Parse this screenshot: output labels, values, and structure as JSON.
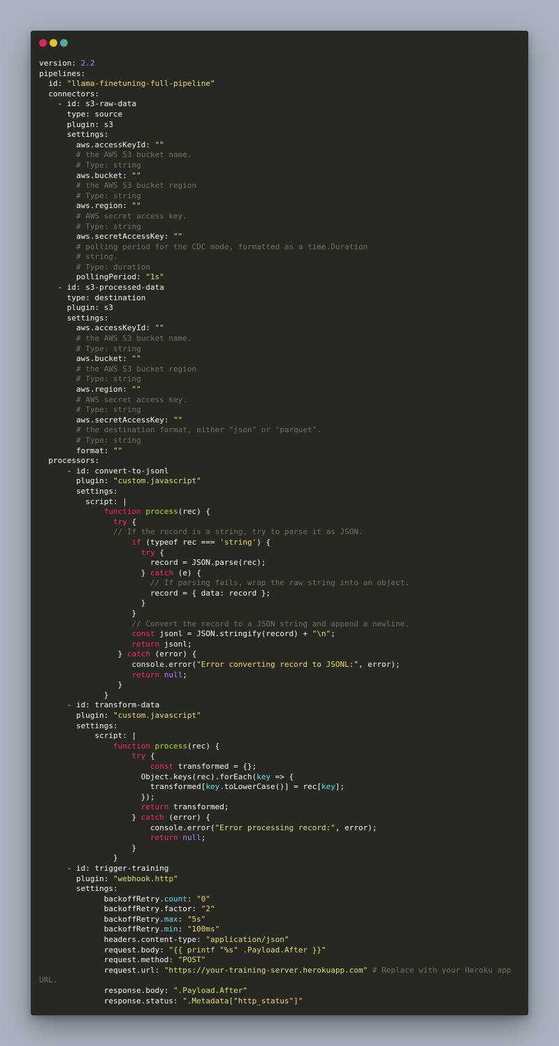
{
  "window": {
    "dots": [
      {
        "name": "close-dot",
        "color": "#e0245e"
      },
      {
        "name": "minimize-dot",
        "color": "#e6c229"
      },
      {
        "name": "zoom-dot",
        "color": "#4ea99a"
      }
    ]
  },
  "code": {
    "lines": [
      [
        [
          "version: ",
          "plain"
        ],
        [
          "2.2",
          "num"
        ]
      ],
      [
        [
          "pipelines:",
          "plain"
        ]
      ],
      [
        [
          "  id: ",
          "plain"
        ],
        [
          "\"llama-finetuning-full-pipeline\"",
          "str"
        ]
      ],
      [
        [
          "  connectors:",
          "plain"
        ]
      ],
      [
        [
          "    - id: s3-raw-data",
          "plain"
        ]
      ],
      [
        [
          "      type: source",
          "plain"
        ]
      ],
      [
        [
          "      plugin: s3",
          "plain"
        ]
      ],
      [
        [
          "      settings:",
          "plain"
        ]
      ],
      [
        [
          "        aws.accessKeyId: ",
          "plain"
        ],
        [
          "\"\"",
          "str"
        ]
      ],
      [
        [
          "        # the AWS S3 bucket name.",
          "com"
        ]
      ],
      [
        [
          "        # Type: string",
          "com"
        ]
      ],
      [
        [
          "        aws.bucket: ",
          "plain"
        ],
        [
          "\"\"",
          "str"
        ]
      ],
      [
        [
          "        # the AWS S3 bucket region",
          "com"
        ]
      ],
      [
        [
          "        # Type: string",
          "com"
        ]
      ],
      [
        [
          "        aws.region: ",
          "plain"
        ],
        [
          "\"\"",
          "str"
        ]
      ],
      [
        [
          "        # AWS secret access key.",
          "com"
        ]
      ],
      [
        [
          "        # Type: string",
          "com"
        ]
      ],
      [
        [
          "        aws.secretAccessKey: ",
          "plain"
        ],
        [
          "\"\"",
          "str"
        ]
      ],
      [
        [
          "        # polling period for the CDC mode, formatted as a time.Duration",
          "com"
        ]
      ],
      [
        [
          "        # string.",
          "com"
        ]
      ],
      [
        [
          "        # Type: duration",
          "com"
        ]
      ],
      [
        [
          "        pollingPeriod: ",
          "plain"
        ],
        [
          "\"1s\"",
          "str"
        ]
      ],
      [
        [
          "    - id: s3-processed-data",
          "plain"
        ]
      ],
      [
        [
          "      type: destination",
          "plain"
        ]
      ],
      [
        [
          "      plugin: s3",
          "plain"
        ]
      ],
      [
        [
          "      settings:",
          "plain"
        ]
      ],
      [
        [
          "        aws.accessKeyId: ",
          "plain"
        ],
        [
          "\"\"",
          "str"
        ]
      ],
      [
        [
          "        # the AWS S3 bucket name.",
          "com"
        ]
      ],
      [
        [
          "        # Type: string",
          "com"
        ]
      ],
      [
        [
          "        aws.bucket: ",
          "plain"
        ],
        [
          "\"\"",
          "str"
        ]
      ],
      [
        [
          "        # the AWS S3 bucket region",
          "com"
        ]
      ],
      [
        [
          "        # Type: string",
          "com"
        ]
      ],
      [
        [
          "        aws.region: ",
          "plain"
        ],
        [
          "\"\"",
          "str"
        ]
      ],
      [
        [
          "        # AWS secret access key.",
          "com"
        ]
      ],
      [
        [
          "        # Type: string",
          "com"
        ]
      ],
      [
        [
          "        aws.secretAccessKey: ",
          "plain"
        ],
        [
          "\"\"",
          "str"
        ]
      ],
      [
        [
          "        # the destination format, either \"json\" or \"parquet\".",
          "com"
        ]
      ],
      [
        [
          "        # Type: string",
          "com"
        ]
      ],
      [
        [
          "        format: ",
          "plain"
        ],
        [
          "\"\"",
          "str"
        ]
      ],
      [
        [
          "  processors:",
          "plain"
        ]
      ],
      [
        [
          "      - id: convert-to-jsonl",
          "plain"
        ]
      ],
      [
        [
          "        plugin: ",
          "plain"
        ],
        [
          "\"custom.javascript\"",
          "str"
        ]
      ],
      [
        [
          "        settings:",
          "plain"
        ]
      ],
      [
        [
          "          script: |",
          "plain"
        ]
      ],
      [
        [
          "              ",
          "plain"
        ],
        [
          "function",
          "kw"
        ],
        [
          " ",
          "plain"
        ],
        [
          "process",
          "fn"
        ],
        [
          "(rec) {",
          "plain"
        ]
      ],
      [
        [
          "                ",
          "plain"
        ],
        [
          "try",
          "kw"
        ],
        [
          " {",
          "plain"
        ]
      ],
      [
        [
          "                // If the record is a string, try to parse it as JSON.",
          "com"
        ]
      ],
      [
        [
          "                    ",
          "plain"
        ],
        [
          "if",
          "kw"
        ],
        [
          " (typeof rec === ",
          "plain"
        ],
        [
          "'string'",
          "str"
        ],
        [
          ") {",
          "plain"
        ]
      ],
      [
        [
          "                      ",
          "plain"
        ],
        [
          "try",
          "kw"
        ],
        [
          " {",
          "plain"
        ]
      ],
      [
        [
          "                        record = JSON.parse(rec);",
          "plain"
        ]
      ],
      [
        [
          "                      } ",
          "plain"
        ],
        [
          "catch",
          "kw"
        ],
        [
          " (e) {",
          "plain"
        ]
      ],
      [
        [
          "                        // If parsing fails, wrap the raw string into an object.",
          "com"
        ]
      ],
      [
        [
          "                        record = { data: record };",
          "plain"
        ]
      ],
      [
        [
          "                      }",
          "plain"
        ]
      ],
      [
        [
          "                    }",
          "plain"
        ]
      ],
      [
        [
          "                    // Convert the record to a JSON string and append a newline.",
          "com"
        ]
      ],
      [
        [
          "                    ",
          "plain"
        ],
        [
          "const",
          "kw"
        ],
        [
          " jsonl = JSON.stringify(record) + ",
          "plain"
        ],
        [
          "\"\\n\"",
          "str"
        ],
        [
          ";",
          "plain"
        ]
      ],
      [
        [
          "                    ",
          "plain"
        ],
        [
          "return",
          "kw"
        ],
        [
          " jsonl;",
          "plain"
        ]
      ],
      [
        [
          "                 } ",
          "plain"
        ],
        [
          "catch",
          "kw"
        ],
        [
          " (error) {",
          "plain"
        ]
      ],
      [
        [
          "                    console.error(",
          "plain"
        ],
        [
          "\"Error converting record to JSONL:\"",
          "str"
        ],
        [
          ", error);",
          "plain"
        ]
      ],
      [
        [
          "                    ",
          "plain"
        ],
        [
          "return",
          "kw"
        ],
        [
          " ",
          "plain"
        ],
        [
          "null",
          "lit"
        ],
        [
          ";",
          "plain"
        ]
      ],
      [
        [
          "                 }",
          "plain"
        ]
      ],
      [
        [
          "              }",
          "plain"
        ]
      ],
      [
        [
          "      - id: transform-data",
          "plain"
        ]
      ],
      [
        [
          "        plugin: ",
          "plain"
        ],
        [
          "\"custom.javascript\"",
          "str"
        ]
      ],
      [
        [
          "        settings:",
          "plain"
        ]
      ],
      [
        [
          "            script: |",
          "plain"
        ]
      ],
      [
        [
          "                ",
          "plain"
        ],
        [
          "function",
          "kw"
        ],
        [
          " ",
          "plain"
        ],
        [
          "process",
          "fn"
        ],
        [
          "(rec) {",
          "plain"
        ]
      ],
      [
        [
          "                    ",
          "plain"
        ],
        [
          "try",
          "kw"
        ],
        [
          " {",
          "plain"
        ]
      ],
      [
        [
          "                        ",
          "plain"
        ],
        [
          "const",
          "kw"
        ],
        [
          " transformed = {};",
          "plain"
        ]
      ],
      [
        [
          "                      Object.keys(rec).forEach(",
          "plain"
        ],
        [
          "key",
          "prop"
        ],
        [
          " => {",
          "plain"
        ]
      ],
      [
        [
          "                        transformed[",
          "plain"
        ],
        [
          "key",
          "prop"
        ],
        [
          ".toLowerCase()] = rec[",
          "plain"
        ],
        [
          "key",
          "prop"
        ],
        [
          "];",
          "plain"
        ]
      ],
      [
        [
          "                      });",
          "plain"
        ]
      ],
      [
        [
          "                      ",
          "plain"
        ],
        [
          "return",
          "kw"
        ],
        [
          " transformed;",
          "plain"
        ]
      ],
      [
        [
          "                    } ",
          "plain"
        ],
        [
          "catch",
          "kw"
        ],
        [
          " (error) {",
          "plain"
        ]
      ],
      [
        [
          "                        console.error(",
          "plain"
        ],
        [
          "\"Error processing record:\"",
          "str"
        ],
        [
          ", error);",
          "plain"
        ]
      ],
      [
        [
          "                        ",
          "plain"
        ],
        [
          "return",
          "kw"
        ],
        [
          " ",
          "plain"
        ],
        [
          "null",
          "lit"
        ],
        [
          ";",
          "plain"
        ]
      ],
      [
        [
          "                    }",
          "plain"
        ]
      ],
      [
        [
          "                }",
          "plain"
        ]
      ],
      [
        [
          "      - id: trigger-training",
          "plain"
        ]
      ],
      [
        [
          "        plugin: ",
          "plain"
        ],
        [
          "\"webhook.http\"",
          "str"
        ]
      ],
      [
        [
          "        settings:",
          "plain"
        ]
      ],
      [
        [
          "              backoffRetry.",
          "plain"
        ],
        [
          "count",
          "prop"
        ],
        [
          ": ",
          "plain"
        ],
        [
          "\"0\"",
          "str"
        ]
      ],
      [
        [
          "              backoffRetry.factor: ",
          "plain"
        ],
        [
          "\"2\"",
          "str"
        ]
      ],
      [
        [
          "              backoffRetry.",
          "plain"
        ],
        [
          "max",
          "prop"
        ],
        [
          ": ",
          "plain"
        ],
        [
          "\"5s\"",
          "str"
        ]
      ],
      [
        [
          "              backoffRetry.",
          "plain"
        ],
        [
          "min",
          "prop"
        ],
        [
          ": ",
          "plain"
        ],
        [
          "\"100ms\"",
          "str"
        ]
      ],
      [
        [
          "              headers.content-type: ",
          "plain"
        ],
        [
          "\"application/json\"",
          "str"
        ]
      ],
      [
        [
          "              request.body: ",
          "plain"
        ],
        [
          "\"{{ printf \"%s\" .Payload.After }}\"",
          "str"
        ]
      ],
      [
        [
          "              request.method: ",
          "plain"
        ],
        [
          "\"POST\"",
          "str"
        ]
      ],
      [
        [
          "              request.url: ",
          "plain"
        ],
        [
          "\"https://your-training-server.herokuapp.com\"",
          "str"
        ],
        [
          " # Replace with your Heroku app URL.",
          "com"
        ]
      ],
      [
        [
          "              response.body: ",
          "plain"
        ],
        [
          "\".Payload.After\"",
          "str"
        ]
      ],
      [
        [
          "              response.status: ",
          "plain"
        ],
        [
          "\".Metadata[\"http_status\"]\"",
          "str"
        ]
      ]
    ]
  }
}
